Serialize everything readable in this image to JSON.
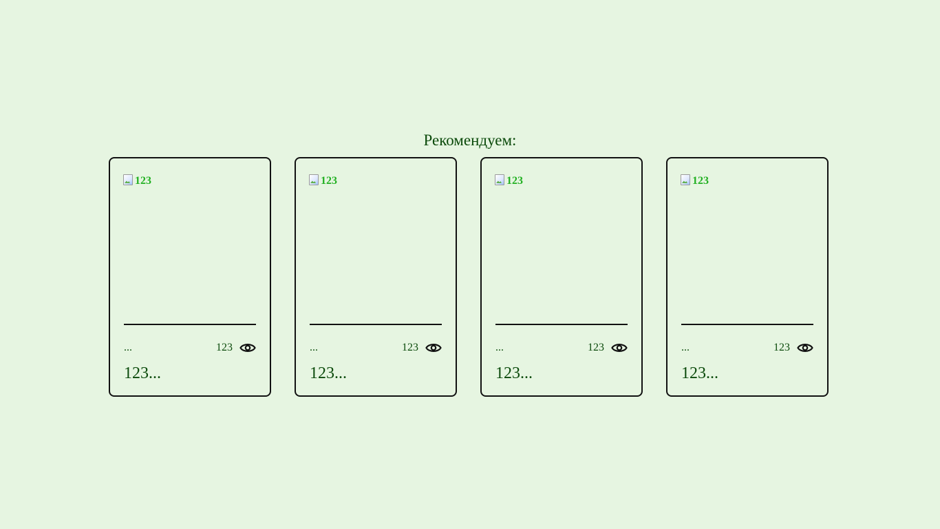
{
  "section": {
    "heading": "Рекомендуем:"
  },
  "cards": [
    {
      "image_alt": "123",
      "meta": "...",
      "views": "123",
      "title": "123...",
      "icon": "eye-icon"
    },
    {
      "image_alt": "123",
      "meta": "...",
      "views": "123",
      "title": "123...",
      "icon": "eye-icon"
    },
    {
      "image_alt": "123",
      "meta": "...",
      "views": "123",
      "title": "123...",
      "icon": "eye-icon"
    },
    {
      "image_alt": "123",
      "meta": "...",
      "views": "123",
      "title": "123...",
      "icon": "eye-icon"
    }
  ],
  "colors": {
    "background": "#e6f5e1",
    "text": "#0b4a0b",
    "border": "#111111",
    "alt_text": "#22b022"
  }
}
